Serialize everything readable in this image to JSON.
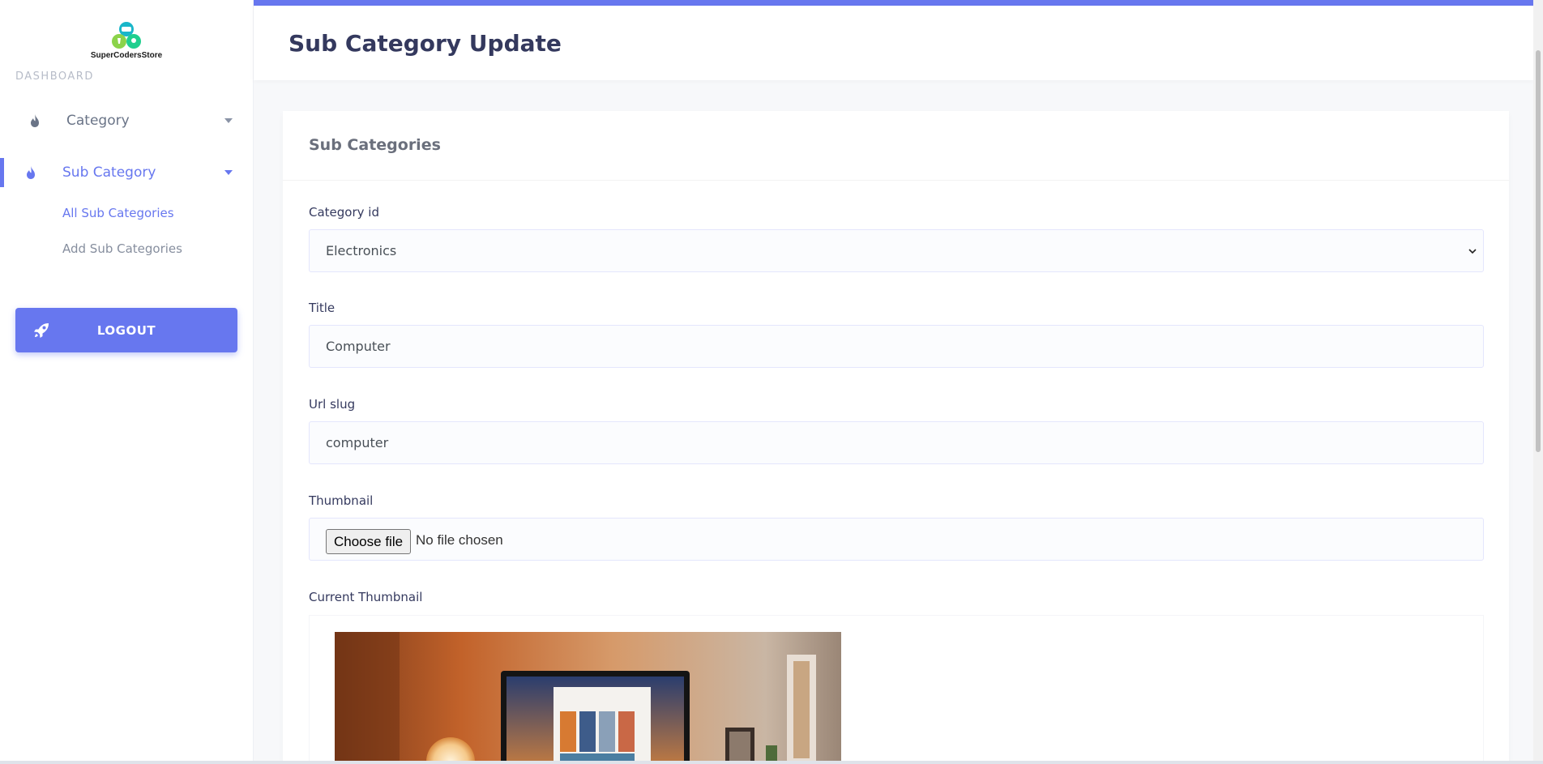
{
  "brand": {
    "name": "SuperCodersStore"
  },
  "sidebar": {
    "section_label": "DASHBOARD",
    "items": [
      {
        "label": "Category",
        "icon": "fire-icon"
      },
      {
        "label": "Sub Category",
        "icon": "fire-icon",
        "active": true,
        "children": [
          {
            "label": "All Sub Categories",
            "active": true
          },
          {
            "label": "Add Sub Categories"
          }
        ]
      }
    ],
    "logout_label": "LOGOUT"
  },
  "header": {
    "title": "Sub Category Update"
  },
  "card": {
    "title": "Sub Categories",
    "fields": {
      "category": {
        "label": "Category id",
        "value": "Electronics",
        "options": [
          "Electronics"
        ]
      },
      "title": {
        "label": "Title",
        "value": "Computer"
      },
      "slug": {
        "label": "Url slug",
        "value": "computer"
      },
      "thumbnail": {
        "label": "Thumbnail",
        "button_label": "Choose file",
        "status": "No file chosen"
      },
      "current_thumbnail": {
        "label": "Current Thumbnail"
      }
    }
  },
  "colors": {
    "accent": "#6777ef",
    "title": "#34395e",
    "muted": "#868e9e"
  }
}
